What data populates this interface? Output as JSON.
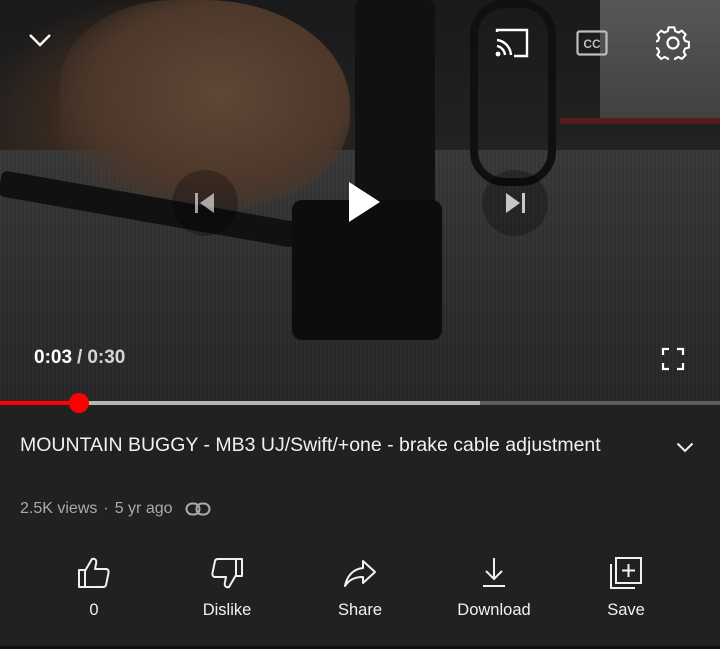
{
  "player": {
    "current_time": "0:03",
    "separator": "/",
    "duration": "0:30",
    "progress_fraction": 0.11,
    "buffered_fraction": 0.667
  },
  "video": {
    "title": "MOUNTAIN BUGGY - MB3 UJ/Swift/+one - brake cable adjustment",
    "views": "2.5K views",
    "dot": "·",
    "age": "5 yr ago"
  },
  "actions": {
    "like_count": "0",
    "dislike_label": "Dislike",
    "share_label": "Share",
    "download_label": "Download",
    "save_label": "Save"
  },
  "colors": {
    "accent": "#ff0000",
    "background": "#212121",
    "secondary_text": "#aaaaaa"
  },
  "icons": [
    "chevron-down-icon",
    "cast-icon",
    "captions-icon",
    "settings-icon",
    "previous-icon",
    "play-icon",
    "next-icon",
    "fullscreen-icon",
    "link-icon",
    "thumbs-up-icon",
    "thumbs-down-icon",
    "share-icon",
    "download-icon",
    "save-playlist-icon"
  ]
}
